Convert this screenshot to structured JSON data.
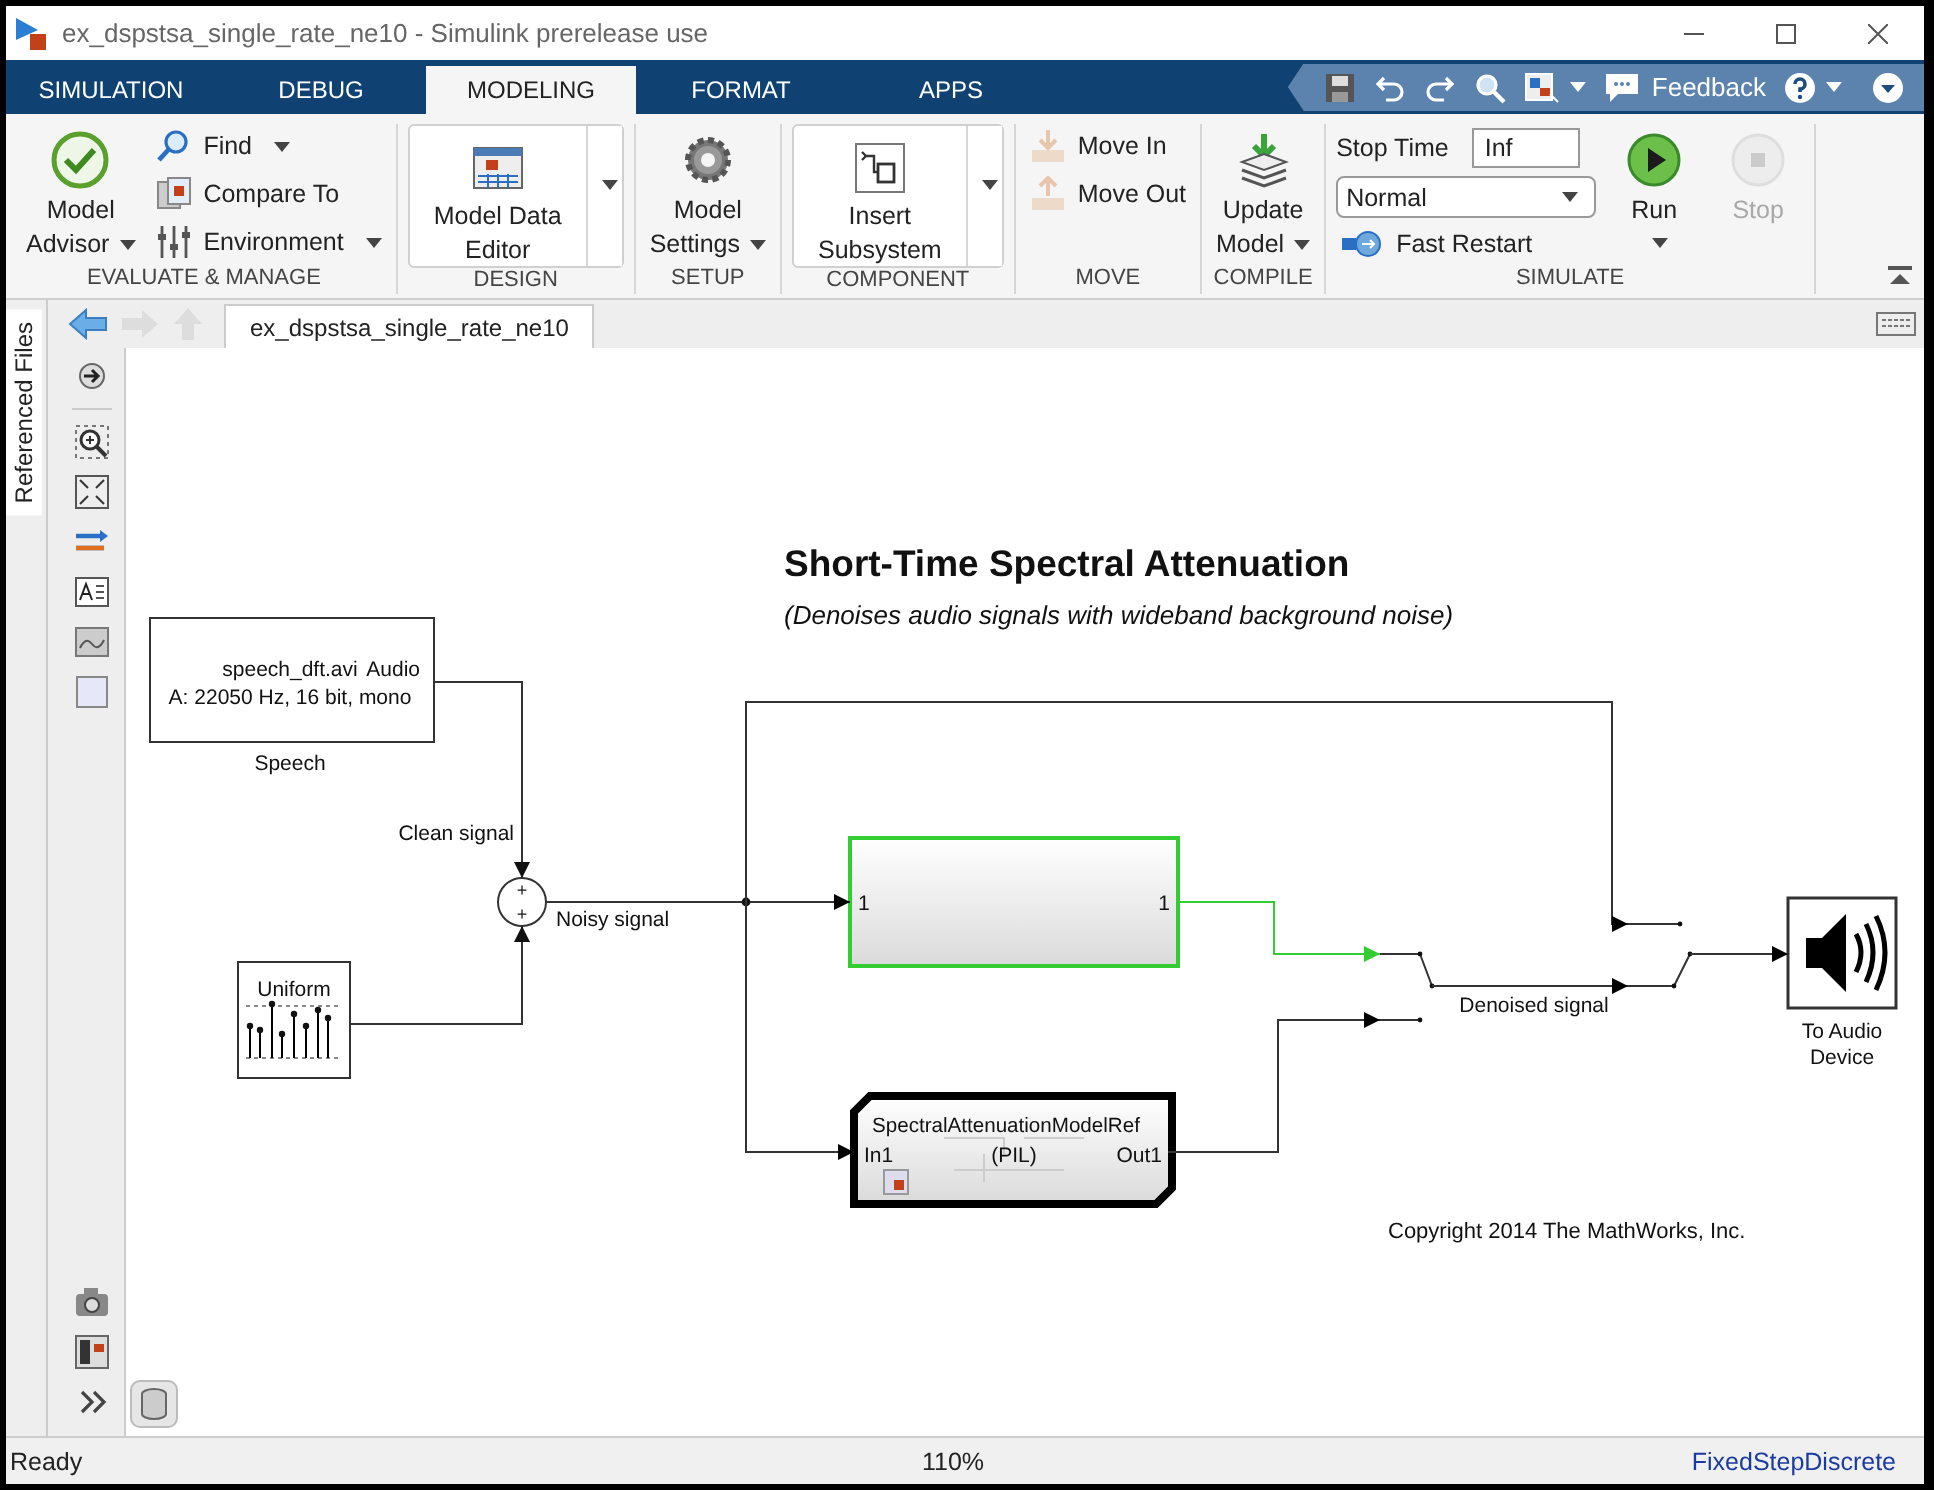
{
  "window": {
    "title": "ex_dspstsa_single_rate_ne10 - Simulink prerelease use"
  },
  "tabs": [
    {
      "label": "SIMULATION",
      "selected": false
    },
    {
      "label": "DEBUG",
      "selected": false
    },
    {
      "label": "MODELING",
      "selected": true
    },
    {
      "label": "FORMAT",
      "selected": false
    },
    {
      "label": "APPS",
      "selected": false
    }
  ],
  "quick_access": {
    "feedback": "Feedback"
  },
  "ribbon": {
    "sections": [
      {
        "title": "EVALUATE & MANAGE",
        "items": [
          {
            "kind": "large",
            "lines": [
              "Model",
              "Advisor"
            ],
            "dropdown": true,
            "disabled": false
          },
          {
            "kind": "small",
            "label": "Find",
            "dropdown": true,
            "disabled": false
          },
          {
            "kind": "small",
            "label": "Compare To",
            "dropdown": false,
            "disabled": false
          },
          {
            "kind": "small",
            "label": "Environment",
            "dropdown": true,
            "disabled": false
          }
        ]
      },
      {
        "title": "DESIGN",
        "items": [
          {
            "kind": "gallery",
            "lines": [
              "Model Data",
              "Editor"
            ],
            "disabled": false
          }
        ]
      },
      {
        "title": "SETUP",
        "items": [
          {
            "kind": "large",
            "lines": [
              "Model",
              "Settings"
            ],
            "dropdown": true,
            "disabled": false
          }
        ]
      },
      {
        "title": "COMPONENT",
        "items": [
          {
            "kind": "gallery",
            "lines": [
              "Insert",
              "Subsystem"
            ],
            "disabled": false
          }
        ]
      },
      {
        "title": "MOVE",
        "items": [
          {
            "kind": "small",
            "label": "Move In",
            "dropdown": false,
            "disabled": true
          },
          {
            "kind": "small",
            "label": "Move Out",
            "dropdown": false,
            "disabled": true
          }
        ]
      },
      {
        "title": "COMPILE",
        "items": [
          {
            "kind": "large",
            "lines": [
              "Update",
              "Model"
            ],
            "dropdown": true,
            "disabled": false
          }
        ]
      },
      {
        "title": "SIMULATE",
        "items": [
          {
            "kind": "field",
            "label": "Stop Time",
            "value": "Inf",
            "disabled": false
          },
          {
            "kind": "select",
            "value": "Normal",
            "disabled": false
          },
          {
            "kind": "small",
            "label": "Fast Restart",
            "dropdown": false,
            "disabled": false
          },
          {
            "kind": "large",
            "lines": [
              "Run"
            ],
            "dropdown": true,
            "disabled": false
          },
          {
            "kind": "large",
            "lines": [
              "Stop"
            ],
            "dropdown": false,
            "disabled": true
          }
        ]
      }
    ]
  },
  "editor": {
    "side_tab": "Referenced Files",
    "breadcrumb": "ex_dspstsa_single_rate_ne10"
  },
  "diagram": {
    "title": "Short-Time Spectral Attenuation",
    "subtitle": "(Denoises audio signals with wideband background noise)",
    "blocks": [
      {
        "kind": "file_source",
        "lines": [
          "speech_dft.avi",
          "A: 22050 Hz, 16 bit, mono"
        ],
        "port": "Audio",
        "name": "Speech"
      },
      {
        "kind": "sum",
        "signs": [
          "+",
          "+"
        ]
      },
      {
        "kind": "random_source",
        "label": "Uniform"
      },
      {
        "kind": "subsystem",
        "in_port": "1",
        "out_port": "1",
        "highlighted": true
      },
      {
        "kind": "model_ref",
        "label": "SpectralAttenuationModelRef",
        "mode": "(PIL)",
        "in_port": "In1",
        "out_port": "Out1"
      },
      {
        "kind": "switch"
      },
      {
        "kind": "switch"
      },
      {
        "kind": "audio_sink",
        "lines": [
          "To Audio",
          "Device"
        ]
      }
    ],
    "signal_labels": [
      "Clean signal",
      "Noisy signal",
      "Denoised signal"
    ],
    "copyright": "Copyright 2014 The MathWorks, Inc."
  },
  "status_bar": {
    "state": "Ready",
    "zoom": "110%",
    "solver": "FixedStepDiscrete"
  }
}
